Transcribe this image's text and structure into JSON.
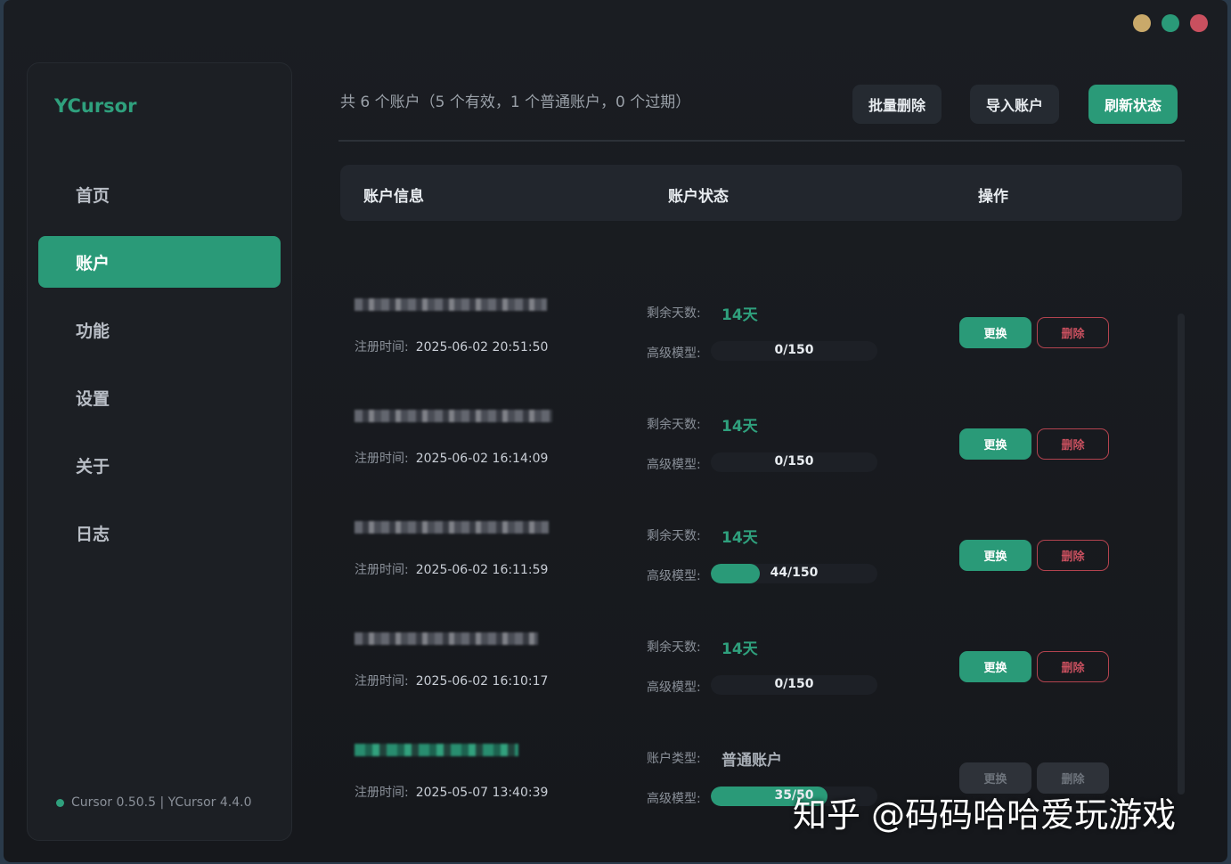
{
  "app": {
    "brand": "YCursor",
    "version": "Cursor 0.50.5 | YCursor 4.4.0"
  },
  "colors": {
    "accent": "#2a9a78",
    "danger": "#c9505f",
    "background": "#16181c"
  },
  "window_controls": [
    "minimize-dot",
    "maximize-dot",
    "close-dot"
  ],
  "nav": [
    {
      "label": "首页",
      "active": false
    },
    {
      "label": "账户",
      "active": true
    },
    {
      "label": "功能",
      "active": false
    },
    {
      "label": "设置",
      "active": false
    },
    {
      "label": "关于",
      "active": false
    },
    {
      "label": "日志",
      "active": false
    }
  ],
  "header": {
    "summary": "共 6 个账户（5 个有效，1 个普通账户，0 个过期）",
    "batch_delete": "批量删除",
    "import": "导入账户",
    "refresh": "刷新状态"
  },
  "table": {
    "columns": [
      "账户信息",
      "账户状态",
      "操作"
    ],
    "labels": {
      "registered": "注册时间:",
      "remaining_days": "剩余天数:",
      "advanced_model": "高级模型:",
      "account_type": "账户类型:",
      "swap": "更换",
      "delete": "删除"
    },
    "rows": [
      {
        "email": "(blurred)",
        "registered": "2025-06-02 20:51:50",
        "days": "14天",
        "usage": "0/150",
        "used": 0,
        "limit": 150,
        "normal": false
      },
      {
        "email": "(blurred)",
        "registered": "2025-06-02 16:14:09",
        "days": "14天",
        "usage": "0/150",
        "used": 0,
        "limit": 150,
        "normal": false
      },
      {
        "email": "(blurred)",
        "registered": "2025-06-02 16:11:59",
        "days": "14天",
        "usage": "44/150",
        "used": 44,
        "limit": 150,
        "normal": false
      },
      {
        "email": "(blurred)",
        "registered": "2025-06-02 16:10:17",
        "days": "14天",
        "usage": "0/150",
        "used": 0,
        "limit": 150,
        "normal": false
      },
      {
        "email": "(blurred)",
        "registered": "2025-05-07 13:40:39",
        "account_type": "普通账户",
        "usage": "35/50",
        "used": 35,
        "limit": 50,
        "normal": true
      }
    ]
  },
  "watermark": "知乎 @码码哈哈爱玩游戏"
}
